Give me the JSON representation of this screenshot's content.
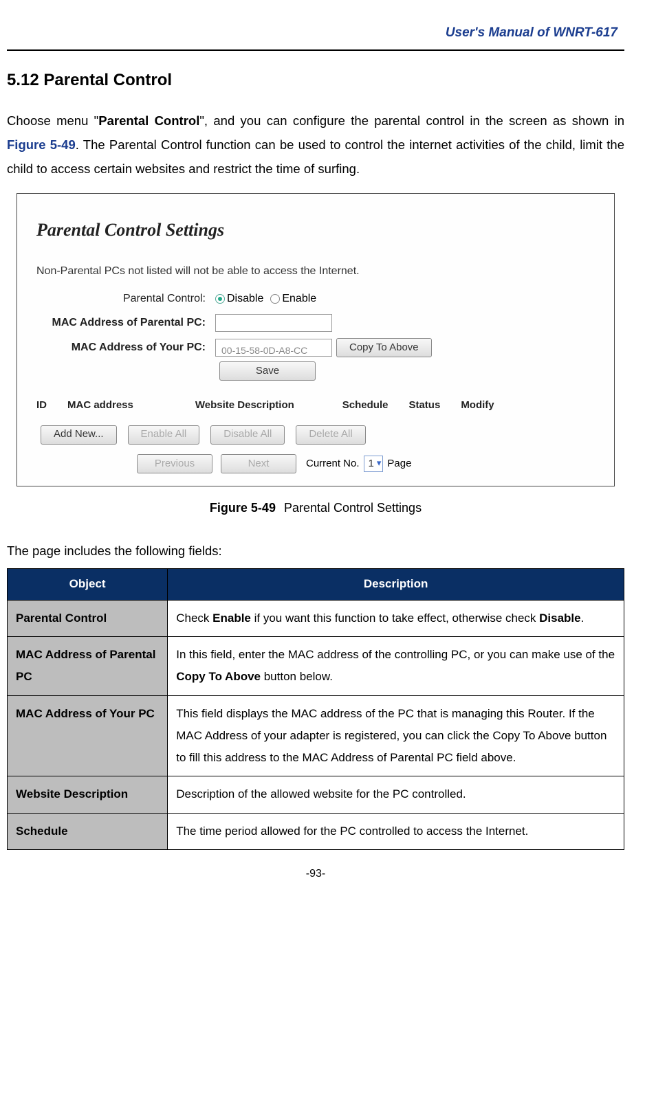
{
  "header": {
    "product": "User's  Manual  of  WNRT-617"
  },
  "section": {
    "number_title": "5.12  Parental Control",
    "intro_pre": "Choose menu \"",
    "intro_bold": "Parental Control",
    "intro_mid": "\", and you can configure the parental control in the screen as shown in ",
    "figure_ref": "Figure 5-49",
    "intro_post": ". The Parental Control function can be used to control the internet activities of the child, limit the child to access certain websites and restrict the time of surfing."
  },
  "figure": {
    "title": "Parental Control Settings",
    "note": "Non-Parental PCs not listed will not be able to access the Internet.",
    "rows": {
      "pc_label": "Parental Control:",
      "disable": "Disable",
      "enable": "Enable",
      "mac_parental_label": "MAC Address of Parental PC:",
      "mac_your_label": "MAC Address of Your PC:",
      "mac_value": "00-15-58-0D-A8-CC",
      "copy_btn": "Copy To Above",
      "save_btn": "Save"
    },
    "cols": {
      "c1": "ID",
      "c2": "MAC address",
      "c3": "Website Description",
      "c4": "Schedule",
      "c5": "Status",
      "c6": "Modify"
    },
    "buttons": {
      "add": "Add New...",
      "enable_all": "Enable All",
      "disable_all": "Disable All",
      "delete_all": "Delete All",
      "prev": "Previous",
      "next": "Next"
    },
    "nav": {
      "current_label": "Current No.",
      "current_value": "1",
      "page_suffix": "Page"
    },
    "caption_label": "Figure 5-49",
    "caption_text": "Parental Control Settings"
  },
  "fields_intro": "The page includes the following fields:",
  "table": {
    "head_obj": "Object",
    "head_desc": "Description",
    "rows": [
      {
        "obj": "Parental Control",
        "desc_pre": "Check ",
        "b1": "Enable",
        "mid1": " if you want this function to take effect, otherwise check ",
        "b2": "Disable",
        "post": "."
      },
      {
        "obj": "MAC Address of Parental PC",
        "desc_pre": "In this field, enter the MAC address of the controlling PC, or you can make use of the ",
        "b1": "Copy To Above",
        "post": " button below."
      },
      {
        "obj": "MAC Address of Your PC",
        "desc_plain": "This field displays the MAC address of the PC that is managing this Router. If the MAC Address of your adapter is registered, you can click the Copy To Above button to fill this address to the MAC Address of Parental PC field above."
      },
      {
        "obj": "Website Description",
        "desc_plain": "Description of the allowed website for the PC controlled."
      },
      {
        "obj": "Schedule",
        "desc_plain": "The time period allowed for the PC controlled to access the Internet."
      }
    ]
  },
  "page_number": "-93-"
}
